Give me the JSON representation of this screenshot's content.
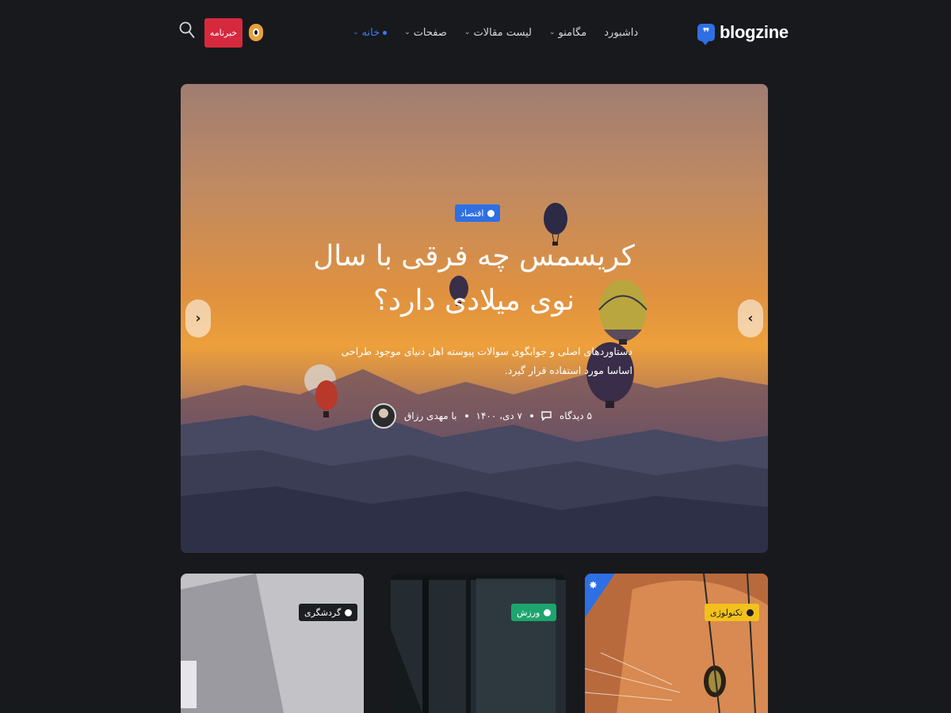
{
  "header": {
    "logo_text": "blogzine",
    "nav": [
      {
        "label": "خانه",
        "active": true
      },
      {
        "label": "صفحات",
        "active": false
      },
      {
        "label": "لیست مقالات",
        "active": false
      },
      {
        "label": "مگامنو",
        "active": false
      },
      {
        "label": "داشبورد",
        "active": false
      }
    ],
    "newsletter_label": "خبرنامه",
    "icons": {
      "search": "search-icon",
      "theme": "dark-mode-toggle-icon"
    },
    "colors": {
      "accent": "#3d7bf2",
      "newsletter": "#d6293e"
    }
  },
  "hero": {
    "category": "اقتصاد",
    "title": "کریسمس چه فرقی با سال نوی میلادی دارد؟",
    "description": "دستاوردهای اصلی و جوابگوی سوالات پیوسته اهل دنیای موجود طراحی اساسا مورد استفاده قرار گیرد.",
    "author": "با مهدی رزاق",
    "date": "۷ دی، ۱۴۰۰",
    "comments": "۵ دیدگاه",
    "prev_arrow": "‹",
    "next_arrow": "›"
  },
  "cards": [
    {
      "category": "گردشگری",
      "badge_color": "#1d1e22"
    },
    {
      "category": "ورزش",
      "badge_color": "#1da56f"
    },
    {
      "category": "تکنولوژی",
      "badge_color": "#f3c11c",
      "featured": true
    }
  ]
}
